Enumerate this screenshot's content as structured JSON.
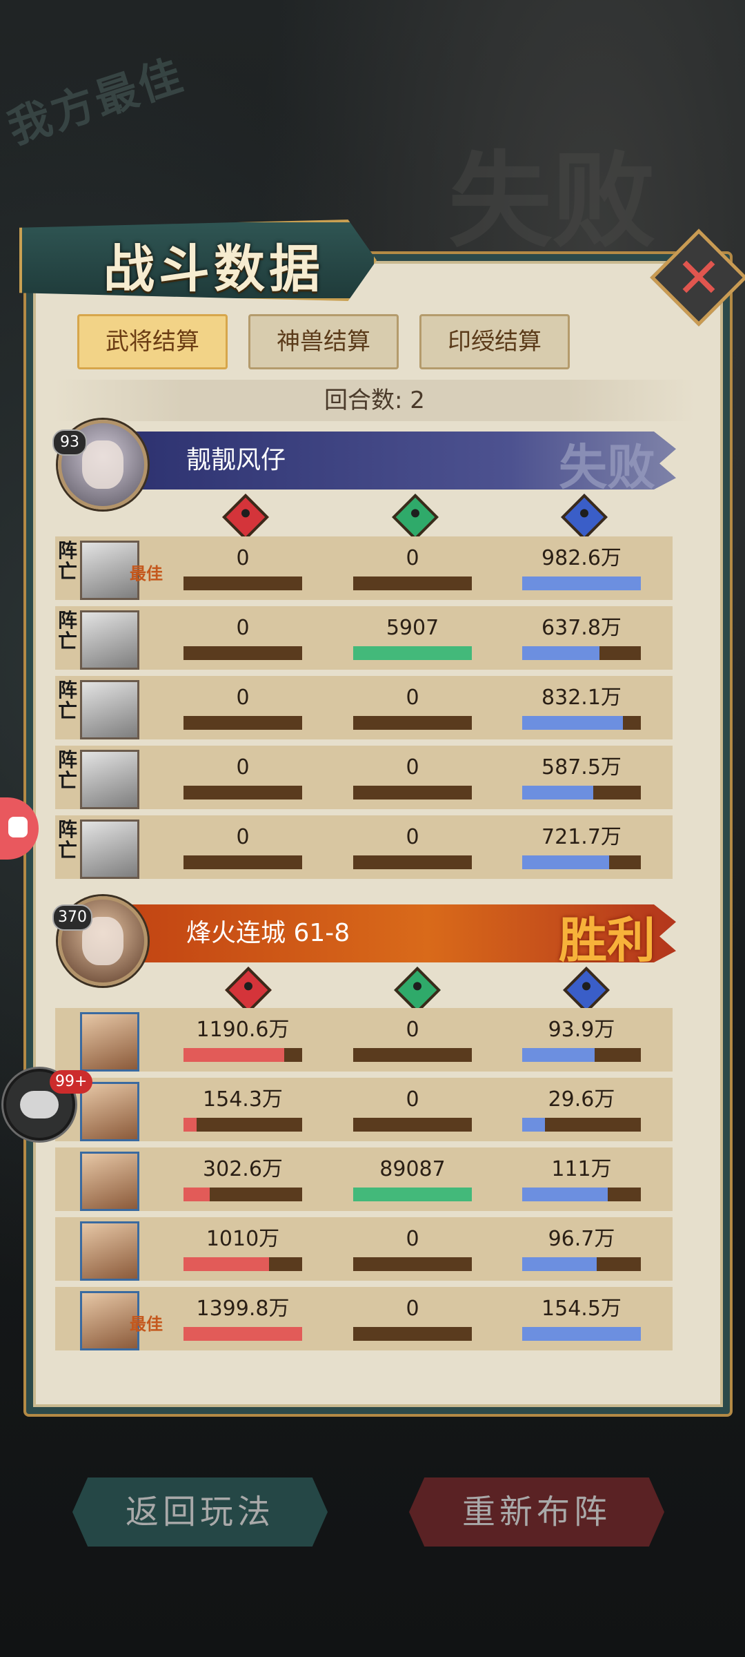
{
  "background": {
    "best_stamp": "我方最佳",
    "defeat_stamp": "失败"
  },
  "panel": {
    "title": "战斗数据",
    "close_icon": "close-x-icon",
    "tabs": [
      {
        "label": "武将结算",
        "active": true
      },
      {
        "label": "神兽结算",
        "active": false
      },
      {
        "label": "印绶结算",
        "active": false
      }
    ],
    "rounds_label": "回合数: 2"
  },
  "teams": [
    {
      "player_name": "靓靓风仔",
      "level": "93",
      "result": "失败",
      "color": "#4d5290",
      "heroes": [
        {
          "tag": "阵亡",
          "best": "最佳",
          "damage": "0",
          "damage_pct": 0,
          "heal": "0",
          "heal_pct": 0,
          "tank": "982.6万",
          "tank_pct": 100
        },
        {
          "tag": "阵亡",
          "best": "",
          "damage": "0",
          "damage_pct": 0,
          "heal": "5907",
          "heal_pct": 100,
          "tank": "637.8万",
          "tank_pct": 65
        },
        {
          "tag": "阵亡",
          "best": "",
          "damage": "0",
          "damage_pct": 0,
          "heal": "0",
          "heal_pct": 0,
          "tank": "832.1万",
          "tank_pct": 85
        },
        {
          "tag": "阵亡",
          "best": "",
          "damage": "0",
          "damage_pct": 0,
          "heal": "0",
          "heal_pct": 0,
          "tank": "587.5万",
          "tank_pct": 60
        },
        {
          "tag": "阵亡",
          "best": "",
          "damage": "0",
          "damage_pct": 0,
          "heal": "0",
          "heal_pct": 0,
          "tank": "721.7万",
          "tank_pct": 73
        }
      ]
    },
    {
      "player_name": "烽火连城 61-8",
      "level": "370",
      "result": "胜利",
      "color": "#d96a1a",
      "heroes": [
        {
          "tag": "",
          "best": "",
          "damage": "1190.6万",
          "damage_pct": 85,
          "heal": "0",
          "heal_pct": 0,
          "tank": "93.9万",
          "tank_pct": 61
        },
        {
          "tag": "",
          "best": "",
          "damage": "154.3万",
          "damage_pct": 11,
          "heal": "0",
          "heal_pct": 0,
          "tank": "29.6万",
          "tank_pct": 19
        },
        {
          "tag": "",
          "best": "",
          "damage": "302.6万",
          "damage_pct": 22,
          "heal": "89087",
          "heal_pct": 100,
          "tank": "111万",
          "tank_pct": 72
        },
        {
          "tag": "",
          "best": "",
          "damage": "1010万",
          "damage_pct": 72,
          "heal": "0",
          "heal_pct": 0,
          "tank": "96.7万",
          "tank_pct": 63
        },
        {
          "tag": "",
          "best": "最佳",
          "damage": "1399.8万",
          "damage_pct": 100,
          "heal": "0",
          "heal_pct": 0,
          "tank": "154.5万",
          "tank_pct": 100
        }
      ]
    }
  ],
  "stat_icons": {
    "damage": "damage-icon",
    "heal": "heal-heart-icon",
    "tank": "shield-icon"
  },
  "bottom": {
    "back_label": "返回玩法",
    "reset_label": "重新布阵"
  },
  "chat": {
    "badge": "99+"
  }
}
